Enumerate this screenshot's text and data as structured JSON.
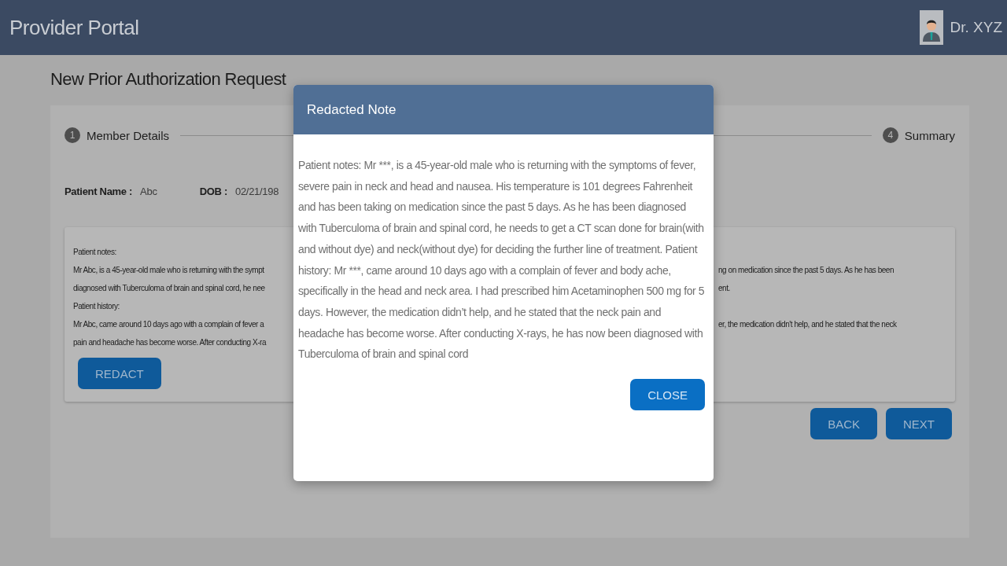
{
  "app_title": "Provider Portal",
  "user": {
    "name": "Dr. XYZ"
  },
  "page_title": "New Prior Authorization Request",
  "steps": [
    {
      "number": "1",
      "label": "Member Details"
    },
    {
      "number": "4",
      "label": "Summary"
    }
  ],
  "patient": {
    "name_label": "Patient Name :",
    "name": "Abc",
    "dob_label": "DOB :",
    "dob": "02/21/198"
  },
  "notes": [
    {
      "left": "Patient notes:"
    },
    {
      "left": "Mr Abc, is a 45-year-old male who is returning with the sympt",
      "right": "ng on medication since the past 5 days. As he has been"
    },
    {
      "left": "diagnosed with Tuberculoma of brain and spinal cord, he nee",
      "right": "ent."
    },
    {
      "left": "Patient history:"
    },
    {
      "left": "Mr Abc, came around 10 days ago with a complain of fever a",
      "right": "er, the medication didn't help, and he stated that the neck"
    },
    {
      "left": "pain and headache has become worse. After conducting X-ra"
    }
  ],
  "redact_button": "REDACT",
  "nav_buttons": [
    "BACK",
    "NEXT"
  ],
  "modal": {
    "title": "Redacted Note",
    "text": "Patient notes: Mr ***, is a 45-year-old male who is returning with the symptoms of fever, severe pain in neck and head and nausea. His temperature is 101 degrees Fahrenheit and has been taking on medication since the past 5 days. As he has been diagnosed with Tuberculoma of brain and spinal cord, he needs to get a CT scan done for brain(with and without dye) and neck(without dye) for deciding the further line of treatment. Patient history: Mr ***, came around 10 days ago with a complain of fever and body ache, specifically in the head and neck area. I had prescribed him Acetaminophen 500 mg for 5 days. However, the medication didn’t help, and he stated that the neck pain and headache has become worse. After conducting X-rays, he has now been diagnosed with Tuberculoma of brain and spinal cord",
    "close_button": "CLOSE"
  }
}
